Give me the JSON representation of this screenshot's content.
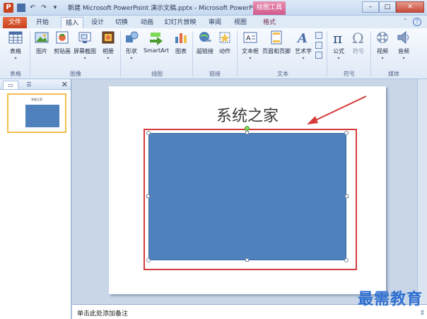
{
  "window": {
    "title": "新建 Microsoft PowerPoint 演示文稿.pptx - Microsoft PowerPo...",
    "context_tool": "绘图工具",
    "app_logo": "P"
  },
  "tabs": [
    {
      "label": "文件",
      "kind": "file"
    },
    {
      "label": "开始",
      "kind": "normal"
    },
    {
      "label": "插入",
      "kind": "active"
    },
    {
      "label": "设计",
      "kind": "normal"
    },
    {
      "label": "切换",
      "kind": "normal"
    },
    {
      "label": "动画",
      "kind": "normal"
    },
    {
      "label": "幻灯片放映",
      "kind": "normal"
    },
    {
      "label": "审阅",
      "kind": "normal"
    },
    {
      "label": "视图",
      "kind": "normal"
    },
    {
      "label": "格式",
      "kind": "context"
    }
  ],
  "ribbon": {
    "buttons": {
      "table": "表格",
      "picture": "图片",
      "clipart": "剪贴画",
      "screenshot": "屏幕截图",
      "album": "相册",
      "shapes": "形状",
      "smartart": "SmartArt",
      "chart": "图表",
      "hyperlink": "超链接",
      "action": "动作",
      "textbox": "文本框",
      "header_footer": "页眉和页脚",
      "wordart": "艺术字",
      "equation": "公式",
      "symbol": "符号",
      "video": "视频",
      "audio": "音频"
    },
    "groups": {
      "tables": "表格",
      "images": "图像",
      "illustrations": "插图",
      "links": "链接",
      "text": "文本",
      "symbols": "符号",
      "media": "媒体"
    }
  },
  "side_pane": {
    "slide_number": "1",
    "thumbnail_title": "系统之家"
  },
  "slide": {
    "title": "系统之家",
    "shape_fill": "#4f81bd",
    "highlight_color": "#d63b3b"
  },
  "notes": {
    "placeholder": "单击此处添加备注"
  },
  "watermark": "最需教育"
}
